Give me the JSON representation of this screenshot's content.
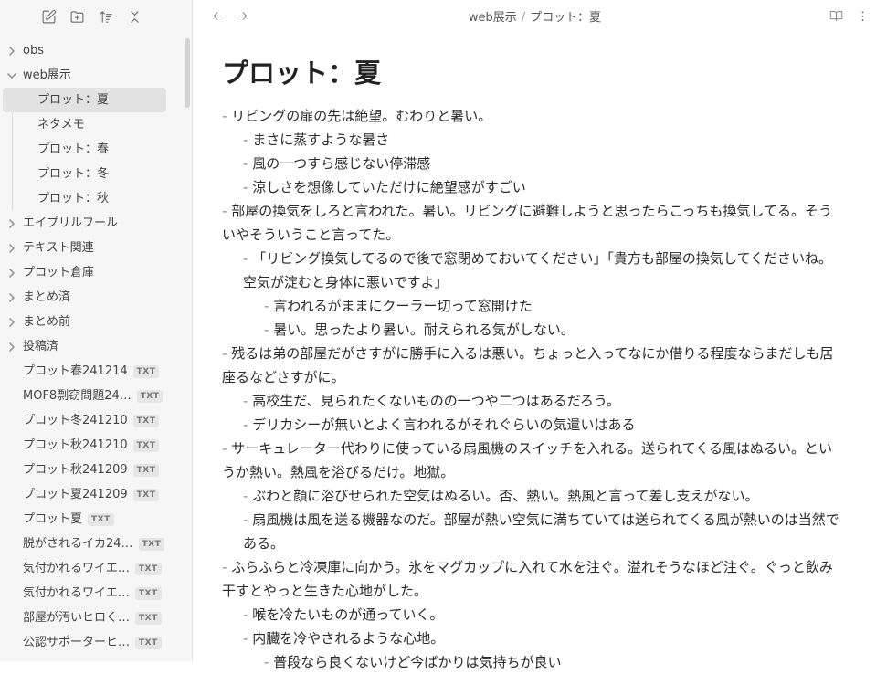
{
  "sidebar": {
    "folders_top": [
      {
        "label": "obs",
        "expanded": false
      },
      {
        "label": "web展示",
        "expanded": true
      }
    ],
    "children": [
      {
        "label": "プロット：夏",
        "active": true
      },
      {
        "label": "ネタメモ"
      },
      {
        "label": "プロット：春"
      },
      {
        "label": "プロット：冬"
      },
      {
        "label": "プロット：秋"
      }
    ],
    "folders_bottom": [
      {
        "label": "エイプリルフール"
      },
      {
        "label": "テキスト関連"
      },
      {
        "label": "プロット倉庫"
      },
      {
        "label": "まとめ済"
      },
      {
        "label": "まとめ前"
      },
      {
        "label": "投稿済"
      }
    ],
    "files": [
      {
        "label": "プロット春241214",
        "badge": "TXT"
      },
      {
        "label": "MOF8剽窃問題24…",
        "badge": "TXT"
      },
      {
        "label": "プロット冬241210",
        "badge": "TXT"
      },
      {
        "label": "プロット秋241210",
        "badge": "TXT"
      },
      {
        "label": "プロット秋241209",
        "badge": "TXT"
      },
      {
        "label": "プロット夏241209",
        "badge": "TXT"
      },
      {
        "label": "プロット夏",
        "badge": "TXT"
      },
      {
        "label": "脱がされるイカ24…",
        "badge": "TXT"
      },
      {
        "label": "気付かれるワイエ…",
        "badge": "TXT"
      },
      {
        "label": "気付かれるワイエ…",
        "badge": "TXT"
      },
      {
        "label": "部屋が汚いヒロく…",
        "badge": "TXT"
      },
      {
        "label": "公認サポーターヒ…",
        "badge": "TXT"
      }
    ]
  },
  "header": {
    "breadcrumb_folder": "web展示",
    "breadcrumb_sep": "/",
    "breadcrumb_file": "プロット：夏"
  },
  "note": {
    "title": "プロット：夏",
    "lines": [
      {
        "level": 1,
        "text": "リビングの扉の先は絶望。むわりと暑い。"
      },
      {
        "level": 2,
        "text": "まさに蒸すような暑さ"
      },
      {
        "level": 2,
        "text": "風の一つすら感じない停滞感"
      },
      {
        "level": 2,
        "text": "涼しさを想像していただけに絶望感がすごい"
      },
      {
        "level": 1,
        "text": "部屋の換気をしろと言われた。暑い。リビングに避難しようと思ったらこっちも換気してる。そういやそういうこと言ってた。"
      },
      {
        "level": 2,
        "text": "「リビング換気してるので後で窓閉めておいてください」「貴方も部屋の換気してくださいね。空気が淀むと身体に悪いですよ」"
      },
      {
        "level": 3,
        "text": "言われるがままにクーラー切って窓開けた"
      },
      {
        "level": 3,
        "text": "暑い。思ったより暑い。耐えられる気がしない。"
      },
      {
        "level": 1,
        "text": "残るは弟の部屋だがさすがに勝手に入るは悪い。ちょっと入ってなにか借りる程度ならまだしも居座るなどさすがに。"
      },
      {
        "level": 2,
        "text": "高校生だ、見られたくないものの一つや二つはあるだろう。"
      },
      {
        "level": 2,
        "text": "デリカシーが無いとよく言われるがそれぐらいの気遣いはある"
      },
      {
        "level": 1,
        "text": "サーキュレーター代わりに使っている扇風機のスイッチを入れる。送られてくる風はぬるい。というか熱い。熱風を浴びるだけ。地獄。"
      },
      {
        "level": 2,
        "text": "ぶわと顔に浴びせられた空気はぬるい。否、熱い。熱風と言って差し支えがない。"
      },
      {
        "level": 2,
        "text": "扇風機は風を送る機器なのだ。部屋が熱い空気に満ちていては送られてくる風が熱いのは当然である。"
      },
      {
        "level": 1,
        "text": "ふらふらと冷凍庫に向かう。氷をマグカップに入れて水を注ぐ。溢れそうなほど注ぐ。ぐっと飲み干すとやっと生きた心地がした。"
      },
      {
        "level": 2,
        "text": "喉を冷たいものが通っていく。"
      },
      {
        "level": 2,
        "text": "内臓を冷やされるような心地。"
      },
      {
        "level": 3,
        "text": "普段なら良くないけど今ばかりは気持ちが良い"
      }
    ]
  },
  "icons": {
    "new_note": "edit-icon",
    "new_folder": "folder-plus-icon",
    "sort": "sort-icon",
    "collapse": "collapse-icon",
    "back": "arrow-left-icon",
    "forward": "arrow-right-icon",
    "reading_view": "book-open-icon",
    "more": "more-vertical-icon"
  }
}
